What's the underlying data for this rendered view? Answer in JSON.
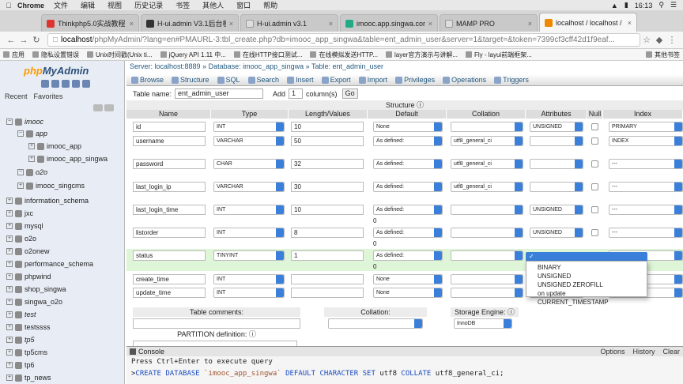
{
  "mac": {
    "app": "Chrome",
    "menus": [
      "文件",
      "编辑",
      "视图",
      "历史记录",
      "书签",
      "其他人",
      "窗口",
      "帮助"
    ],
    "clock": "16:13"
  },
  "tabs": [
    {
      "title": "Thinkphp5.0实战教程",
      "color": "#d33"
    },
    {
      "title": "H-ui.admin V3.1后台模",
      "color": "#333"
    },
    {
      "title": "H-ui.admin v3.1",
      "color": "#ddd"
    },
    {
      "title": "imooc.app.singwa.com",
      "color": "#2a8"
    },
    {
      "title": "MAMP PRO",
      "color": "#ddd"
    },
    {
      "title": "localhost / localhost / ",
      "color": "#e80"
    }
  ],
  "url": {
    "host": "localhost",
    "rest": "/phpMyAdmin/?lang=en#PMAURL-3:tbl_create.php?db=imooc_app_singwa&table=ent_admin_user&server=1&target=&token=7399cf3cff42d1f9eaf..."
  },
  "bookmarks": [
    "应用",
    "隐私设置错误",
    "Unix时间戳(Unix ti...",
    "jQuery API 1.11 中...",
    "在线HTTP接口测试...",
    "在线模拟发送HTTP...",
    "layer官方演示与讲解...",
    "Fly - layui前端框架..."
  ],
  "bookmarks_other": "其他书签",
  "sidebar": {
    "logo_a": "php",
    "logo_b": "MyAdmin",
    "tab_recent": "Recent",
    "tab_favorites": "Favorites",
    "tree": [
      {
        "label": "imooc",
        "italic": true
      },
      {
        "label": "app",
        "italic": true
      },
      {
        "label": "imooc_app",
        "italic": false
      },
      {
        "label": "imooc_app_singwa",
        "italic": false
      },
      {
        "label": "o2o",
        "italic": true
      },
      {
        "label": "imooc_singcms",
        "italic": false
      },
      {
        "label": "information_schema",
        "italic": false
      },
      {
        "label": "jxc",
        "italic": false
      },
      {
        "label": "mysql",
        "italic": false
      },
      {
        "label": "o2o",
        "italic": false
      },
      {
        "label": "o2onew",
        "italic": false
      },
      {
        "label": "performance_schema",
        "italic": false
      },
      {
        "label": "phpwind",
        "italic": false
      },
      {
        "label": "shop_singwa",
        "italic": false
      },
      {
        "label": "singwa_o2o",
        "italic": false
      },
      {
        "label": "test",
        "italic": true
      },
      {
        "label": "testssss",
        "italic": false
      },
      {
        "label": "tp5",
        "italic": true
      },
      {
        "label": "tp5cms",
        "italic": false
      },
      {
        "label": "tp6",
        "italic": false
      },
      {
        "label": "tp_news",
        "italic": false
      }
    ]
  },
  "breadcrumb": {
    "server": "Server: localhost:8889",
    "database": "Database: imooc_app_singwa",
    "table": "Table: ent_admin_user"
  },
  "menu": [
    "Browse",
    "Structure",
    "SQL",
    "Search",
    "Insert",
    "Export",
    "Import",
    "Privileges",
    "Operations",
    "Triggers"
  ],
  "form": {
    "table_name_label": "Table name:",
    "table_name": "ent_admin_user",
    "add_label": "Add",
    "add_count": "1",
    "columns_label": "column(s)",
    "go": "Go",
    "structure_label": "Structure"
  },
  "headers": [
    "Name",
    "Type",
    "Length/Values",
    "Default",
    "Collation",
    "Attributes",
    "Null",
    "Index"
  ],
  "rows": [
    {
      "name": "id",
      "type": "INT",
      "length": "10",
      "default": "None",
      "collation": "",
      "attributes": "UNSIGNED",
      "index": "PRIMARY",
      "zero": ""
    },
    {
      "name": "username",
      "type": "VARCHAR",
      "length": "50",
      "default": "As defined:",
      "collation": "utf8_general_ci",
      "attributes": "",
      "index": "INDEX",
      "zero": ""
    },
    {
      "name": "password",
      "type": "CHAR",
      "length": "32",
      "default": "As defined:",
      "collation": "utf8_general_ci",
      "attributes": "",
      "index": "---",
      "zero": ""
    },
    {
      "name": "last_login_ip",
      "type": "VARCHAR",
      "length": "30",
      "default": "As defined:",
      "collation": "utf8_general_ci",
      "attributes": "",
      "index": "---",
      "zero": ""
    },
    {
      "name": "last_login_time",
      "type": "INT",
      "length": "10",
      "default": "As defined:",
      "collation": "",
      "attributes": "UNSIGNED",
      "index": "---",
      "zero": "0"
    },
    {
      "name": "listorder",
      "type": "INT",
      "length": "8",
      "default": "As defined:",
      "collation": "",
      "attributes": "UNSIGNED",
      "index": "---",
      "zero": "0"
    },
    {
      "name": "status",
      "type": "TINYINT",
      "length": "1",
      "default": "As defined:",
      "collation": "",
      "attributes": "",
      "index": "---",
      "zero": "0"
    },
    {
      "name": "create_time",
      "type": "INT",
      "length": "",
      "default": "None",
      "collation": "",
      "attributes": "",
      "index": "---",
      "zero": ""
    },
    {
      "name": "update_time",
      "type": "INT",
      "length": "",
      "default": "None",
      "collation": "",
      "attributes": "",
      "index": "---",
      "zero": ""
    }
  ],
  "attr_dropdown": {
    "selected": "✓",
    "options": [
      "BINARY",
      "UNSIGNED",
      "UNSIGNED ZEROFILL",
      "on update CURRENT_TIMESTAMP"
    ]
  },
  "bottom": {
    "table_comments": "Table comments:",
    "collation": "Collation:",
    "storage_engine": "Storage Engine:",
    "engine_value": "InnoDB",
    "partition": "PARTITION definition:"
  },
  "console": {
    "title": "Console",
    "options": [
      "Options",
      "History",
      "Clear"
    ],
    "hint": "Press Ctrl+Enter to execute query",
    "sql_prompt": ">",
    "sql_kw1": "CREATE DATABASE",
    "sql_str": "`imooc_app_singwa`",
    "sql_kw2": "DEFAULT CHARACTER SET",
    "sql_v1": "utf8",
    "sql_kw3": "COLLATE",
    "sql_v2": "utf8_general_ci;"
  }
}
